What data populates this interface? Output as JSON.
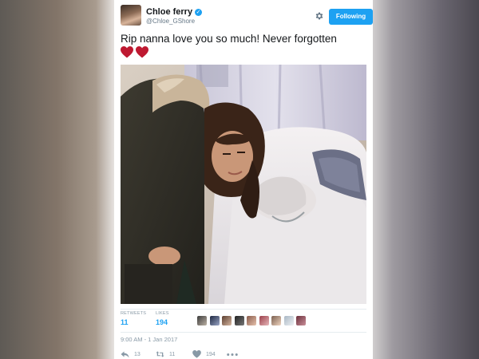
{
  "profile": {
    "display_name": "Chloe ferry",
    "handle": "@Chloe_GShore"
  },
  "follow_button_label": "Following",
  "tweet": {
    "text": "Rip nanna love you so much! Never forgotten",
    "hearts_count": 2,
    "timestamp": "9:00 AM - 1 Jan 2017"
  },
  "stats": {
    "retweets_label": "RETWEETS",
    "retweets_value": "11",
    "likes_label": "LIKES",
    "likes_value": "194"
  },
  "actions": {
    "reply_count": "13",
    "retweet_count": "11",
    "like_count": "194"
  },
  "icons": [
    "verified-badge-icon",
    "gear-icon",
    "heart-emoji-icon",
    "reply-icon",
    "retweet-icon",
    "like-icon",
    "more-icon"
  ],
  "colors": {
    "accent": "#1da1f2",
    "text": "#14171a",
    "muted": "#8899a6",
    "heart": "#be1931"
  }
}
